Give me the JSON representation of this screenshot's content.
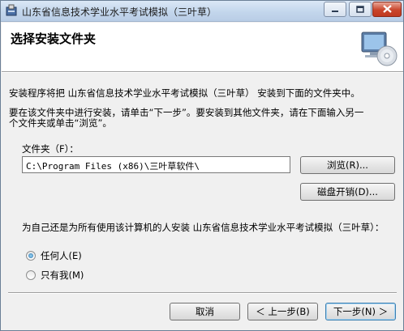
{
  "window": {
    "title": "山东省信息技术学业水平考试模拟（三叶草）"
  },
  "header": {
    "title": "选择安装文件夹"
  },
  "body": {
    "line1": "安装程序将把 山东省信息技术学业水平考试模拟（三叶草） 安装到下面的文件夹中。",
    "line2": "要在该文件夹中进行安装，请单击“下一步”。要安装到其他文件夹，请在下面输入另一",
    "line3": "个文件夹或单击“浏览”。",
    "folder_label": "文件夹（F）：",
    "folder_value": "C:\\Program Files (x86)\\三叶草软件\\",
    "browse_label": "浏览(R)...",
    "disk_cost_label": "磁盘开销(D)...",
    "who_question": "为自己还是为所有使用该计算机的人安装 山东省信息技术学业水平考试模拟（三叶草）：",
    "option_everyone": "任何人(E)",
    "option_just_me": "只有我(M)",
    "selected_option": "everyone"
  },
  "footer": {
    "cancel_label": "取消",
    "back_label": "＜ 上一步(B)",
    "next_label": "下一步(N) ＞"
  }
}
